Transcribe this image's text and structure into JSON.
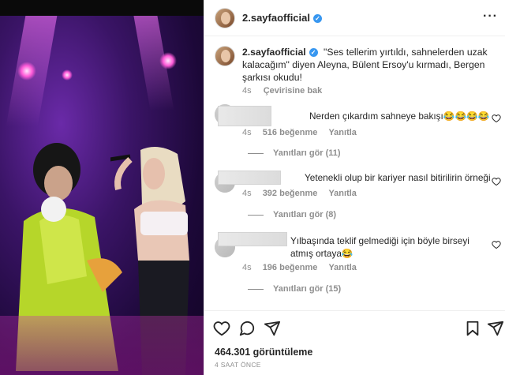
{
  "post": {
    "username": "2.sayfaofficial",
    "verified_mark": "✓",
    "more_label": "···"
  },
  "caption": {
    "username": "2.sayfaofficial",
    "text": "\"Ses tellerim yırtıldı, sahnelerden uzak kalacağım\" diyen Aleyna, Bülent Ersoy'u kırmadı, Bergen şarkısı okudu!",
    "age": "4s",
    "translate_label": "Çevirisine bak"
  },
  "comments": [
    {
      "text": "Nerden çıkardım sahneye bakışı😂😂😂😂",
      "age": "4s",
      "likes": "516 beğenme",
      "reply_label": "Yanıtla",
      "replies_label": "Yanıtları gör (11)"
    },
    {
      "text": "Yetenekli olup bir kariyer nasıl bitirilirin örneği",
      "age": "4s",
      "likes": "392 beğenme",
      "reply_label": "Yanıtla",
      "replies_label": "Yanıtları gör (8)"
    },
    {
      "text": "Yılbaşında teklif gelmediği için böyle birseyi atmış ortaya😂",
      "age": "4s",
      "likes": "196 beğenme",
      "reply_label": "Yanıtla",
      "replies_label": "Yanıtları gör (15)"
    }
  ],
  "footer": {
    "views": "464.301 görüntüleme",
    "posted": "4 SAAT ÖNCE"
  },
  "icons": [
    "heart-icon",
    "comment-icon",
    "share-icon",
    "bookmark-icon",
    "more-icon",
    "verified-icon"
  ],
  "colors": {
    "verified": "#3897f0",
    "muted": "#8e8e8e",
    "text": "#262626"
  }
}
